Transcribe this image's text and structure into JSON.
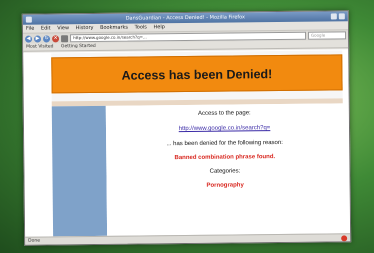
{
  "window": {
    "title": "DansGuardian - Access Denied! - Mozilla Firefox"
  },
  "menu": {
    "items": [
      "File",
      "Edit",
      "View",
      "History",
      "Bookmarks",
      "Tools",
      "Help"
    ]
  },
  "nav": {
    "url": "http://www.google.co.in/search?q=...",
    "search_placeholder": "Google"
  },
  "bookmarks": {
    "items": [
      "Most Visited",
      "Getting Started"
    ]
  },
  "page": {
    "heading": "Access has been Denied!",
    "access_label": "Access to the page:",
    "blocked_url": "http://www.google.co.in/search?q=",
    "denied_text": "... has been denied for the following reason:",
    "reason": "Banned combination phrase found.",
    "categories_label": "Categories:",
    "category": "Pornography"
  },
  "status": {
    "text": "Done"
  },
  "colors": {
    "banner": "#f28a0f",
    "sidebar": "#7fa2c9",
    "reason": "#d8261e",
    "link": "#3a2aa6"
  }
}
